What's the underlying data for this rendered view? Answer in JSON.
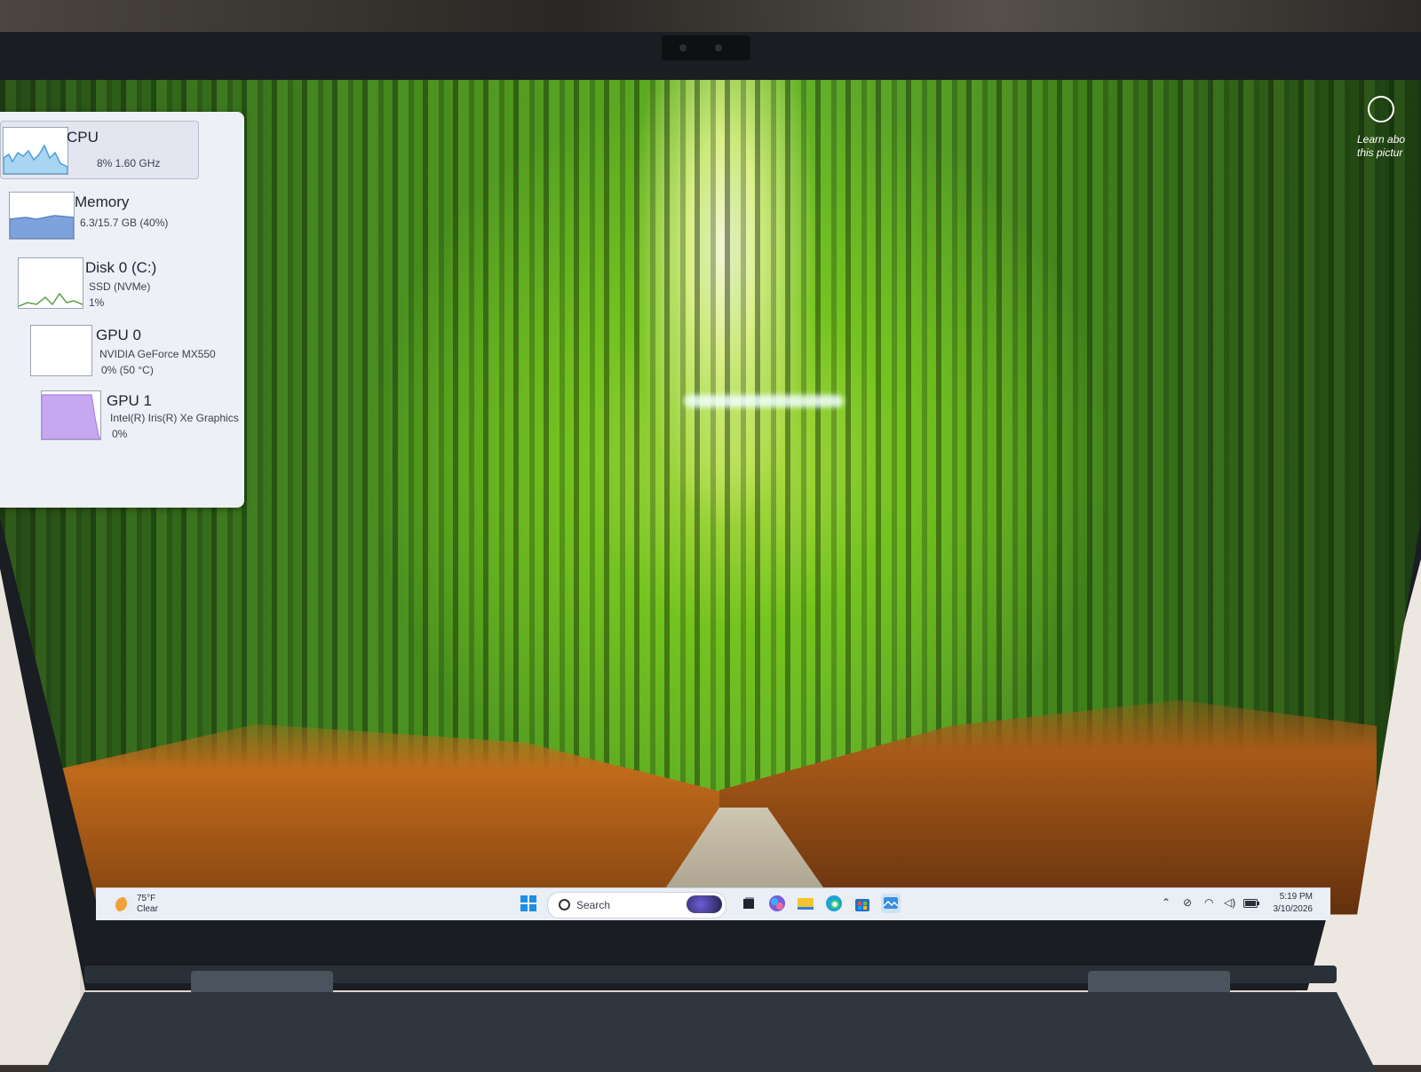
{
  "performance_panel": {
    "items": [
      {
        "name": "CPU",
        "line1": "8%  1.60 GHz",
        "line2": ""
      },
      {
        "name": "Memory",
        "line1": "6.3/15.7 GB (40%)",
        "line2": ""
      },
      {
        "name": "Disk 0 (C:)",
        "line1": "SSD (NVMe)",
        "line2": "1%"
      },
      {
        "name": "GPU 0",
        "line1": "NVIDIA GeForce MX550",
        "line2": "0%  (50 °C)"
      },
      {
        "name": "GPU 1",
        "line1": "Intel(R) Iris(R) Xe Graphics",
        "line2": "0%"
      }
    ],
    "colors": {
      "cpu": "#4a9fd8",
      "memory": "#5b82c9",
      "disk": "#5e9e48",
      "gpu1": "#b48ae8"
    }
  },
  "desktop_widget": {
    "line1": "Learn abo",
    "line2": "this pictur"
  },
  "taskbar": {
    "weather": {
      "temp": "75°F",
      "condition": "Clear"
    },
    "search": {
      "label": "Search"
    },
    "clock": {
      "time": "5:19 PM",
      "date": "3/10/2026"
    },
    "tray_icons": [
      "chevron-up-icon",
      "network-off-icon",
      "wifi-icon",
      "volume-icon",
      "battery-icon"
    ],
    "pinned": [
      "task-view-icon",
      "copilot-icon",
      "file-explorer-icon",
      "edge-icon",
      "store-icon",
      "photos-icon"
    ]
  }
}
